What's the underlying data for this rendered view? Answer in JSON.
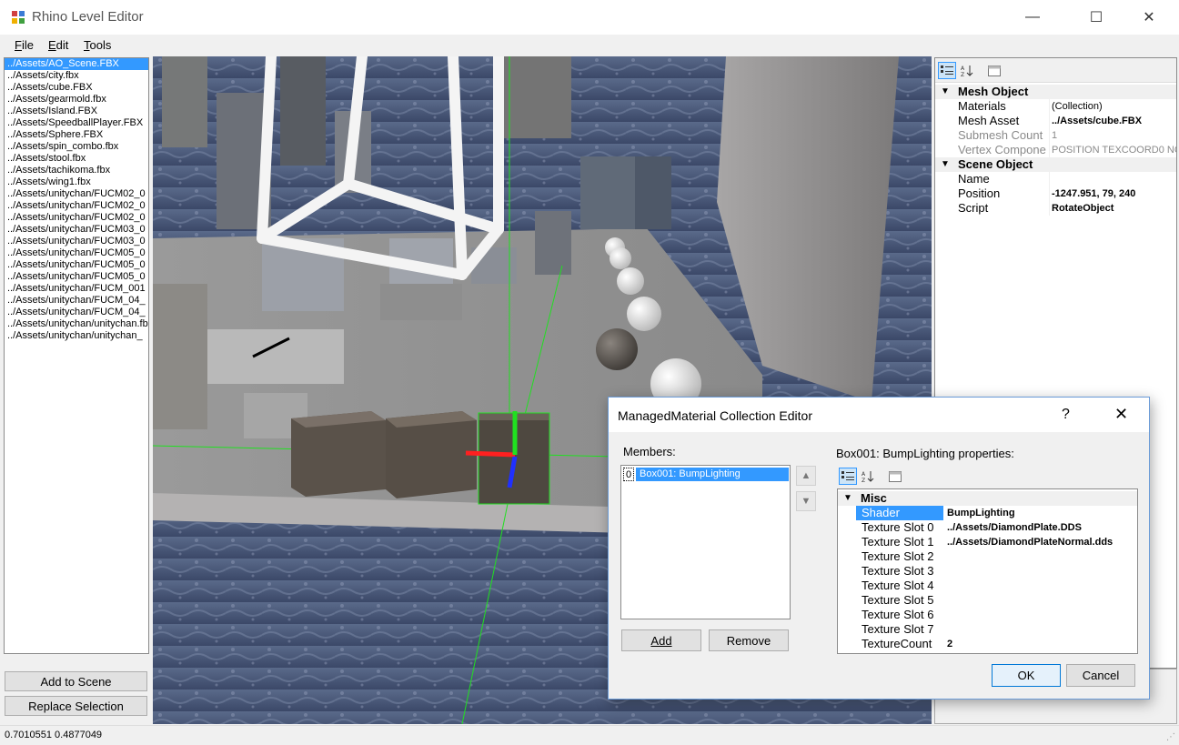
{
  "window": {
    "title": "Rhino Level Editor",
    "minimize_glyph": "—",
    "maximize_glyph": "☐",
    "close_glyph": "✕"
  },
  "menu": [
    {
      "label": "File",
      "mnemonic": "F",
      "rest": "ile"
    },
    {
      "label": "Edit",
      "mnemonic": "E",
      "rest": "dit"
    },
    {
      "label": "Tools",
      "mnemonic": "T",
      "rest": "ools"
    }
  ],
  "assets": [
    "../Assets/AO_Scene.FBX",
    "../Assets/city.fbx",
    "../Assets/cube.FBX",
    "../Assets/gearmold.fbx",
    "../Assets/Island.FBX",
    "../Assets/SpeedballPlayer.FBX",
    "../Assets/Sphere.FBX",
    "../Assets/spin_combo.fbx",
    "../Assets/stool.fbx",
    "../Assets/tachikoma.fbx",
    "../Assets/wing1.fbx",
    "../Assets/unitychan/FUCM02_0",
    "../Assets/unitychan/FUCM02_0",
    "../Assets/unitychan/FUCM02_0",
    "../Assets/unitychan/FUCM03_0",
    "../Assets/unitychan/FUCM03_0",
    "../Assets/unitychan/FUCM05_0",
    "../Assets/unitychan/FUCM05_0",
    "../Assets/unitychan/FUCM05_0",
    "../Assets/unitychan/FUCM_001",
    "../Assets/unitychan/FUCM_04_",
    "../Assets/unitychan/FUCM_04_",
    "../Assets/unitychan/unitychan.fb",
    "../Assets/unitychan/unitychan_"
  ],
  "selected_asset_index": 0,
  "buttons": {
    "add_to_scene": "Add to Scene",
    "replace_selection": "Replace Selection"
  },
  "property_grid": {
    "categories": [
      {
        "name": "Mesh Object",
        "props": [
          {
            "name": "Materials",
            "value": "(Collection)",
            "bold": false,
            "disabled": false
          },
          {
            "name": "Mesh Asset",
            "value": "../Assets/cube.FBX",
            "bold": true,
            "disabled": false
          },
          {
            "name": "Submesh Count",
            "value": "1",
            "bold": false,
            "disabled": true
          },
          {
            "name": "Vertex Compone",
            "value": "POSITION TEXCOORD0 NO",
            "bold": false,
            "disabled": true
          }
        ]
      },
      {
        "name": "Scene Object",
        "props": [
          {
            "name": "Name",
            "value": "",
            "bold": false,
            "disabled": false
          },
          {
            "name": "Position",
            "value": "-1247.951, 79, 240",
            "bold": true,
            "disabled": false
          },
          {
            "name": "Script",
            "value": "RotateObject",
            "bold": true,
            "disabled": false
          }
        ]
      }
    ]
  },
  "status": {
    "text": "0.7010551 0.4877049"
  },
  "dialog": {
    "title": "ManagedMaterial Collection Editor",
    "help_glyph": "?",
    "close_glyph": "✕",
    "members_label": "Members:",
    "members": [
      {
        "index": "0",
        "name": "Box001: BumpLighting"
      }
    ],
    "properties_label": "Box001: BumpLighting properties:",
    "category": "Misc",
    "props": [
      {
        "name": "Shader",
        "value": "BumpLighting"
      },
      {
        "name": "Texture Slot 0",
        "value": "../Assets/DiamondPlate.DDS"
      },
      {
        "name": "Texture Slot 1",
        "value": "../Assets/DiamondPlateNormal.dds"
      },
      {
        "name": "Texture Slot 2",
        "value": ""
      },
      {
        "name": "Texture Slot 3",
        "value": ""
      },
      {
        "name": "Texture Slot 4",
        "value": ""
      },
      {
        "name": "Texture Slot 5",
        "value": ""
      },
      {
        "name": "Texture Slot 6",
        "value": ""
      },
      {
        "name": "Texture Slot 7",
        "value": ""
      },
      {
        "name": "TextureCount",
        "value": "2"
      }
    ],
    "add_label": "Add",
    "remove_label": "Remove",
    "ok_label": "OK",
    "cancel_label": "Cancel"
  },
  "colors": {
    "selection": "#3399ff",
    "gizmo_x": "#ff2020",
    "gizmo_y": "#20e020",
    "gizmo_z": "#2030ff"
  }
}
